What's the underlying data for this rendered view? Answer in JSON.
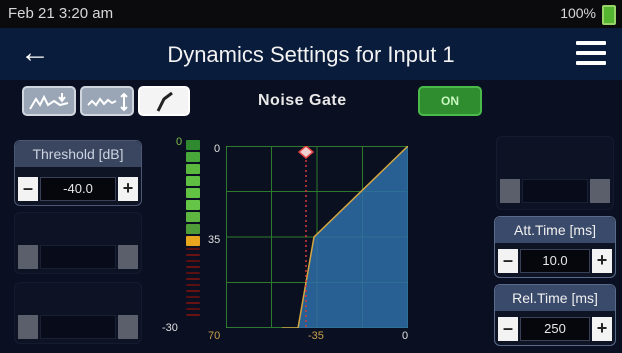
{
  "status": {
    "time": "Feb 21 3:20 am",
    "battery": "100%"
  },
  "header": {
    "title": "Dynamics Settings for Input 1"
  },
  "mode": {
    "title": "Noise Gate",
    "power": "ON"
  },
  "threshold": {
    "label": "Threshold [dB]",
    "value": "-40.0"
  },
  "attack": {
    "label": "Att.Time [ms]",
    "value": "10.0"
  },
  "release": {
    "label": "Rel.Time [ms]",
    "value": "250"
  },
  "meter": {
    "top_label": "0",
    "bottom_label": "-30"
  },
  "graph": {
    "y_top": "0",
    "y_mid": "35",
    "y_bottom": "70",
    "x_mid": "-35",
    "x_right": "0"
  },
  "colors": {
    "accent_green": "#4aba4a",
    "header_bg": "#0a1c3b",
    "graph_fill": "#2f6fa8"
  }
}
